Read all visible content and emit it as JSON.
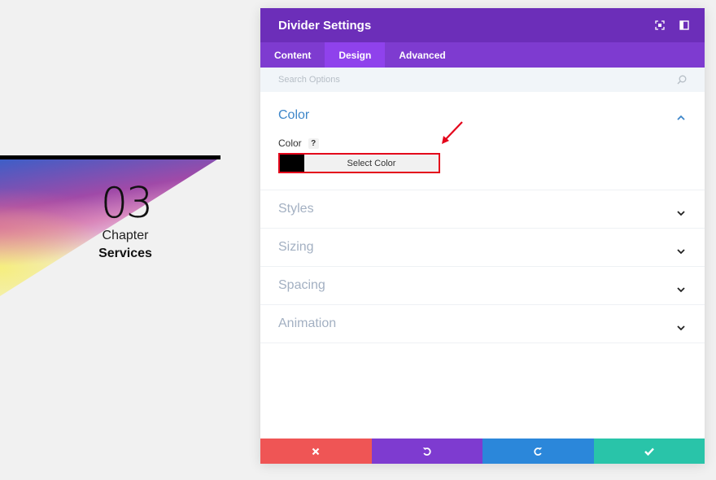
{
  "preview": {
    "number": "03",
    "chapter": "Chapter",
    "title": "Services"
  },
  "modal": {
    "title": "Divider Settings",
    "tabs": [
      {
        "label": "Content",
        "active": false
      },
      {
        "label": "Design",
        "active": true
      },
      {
        "label": "Advanced",
        "active": false
      }
    ],
    "search": {
      "placeholder": "Search Options",
      "value": ""
    },
    "color_section": {
      "title": "Color",
      "field_label": "Color",
      "help": "?",
      "swatch_color": "#000000",
      "button_label": "Select Color"
    },
    "sections": [
      {
        "title": "Styles"
      },
      {
        "title": "Sizing"
      },
      {
        "title": "Spacing"
      },
      {
        "title": "Animation"
      }
    ]
  },
  "colors": {
    "header": "#6c2eb9",
    "tabs": "#7e3bd0",
    "cancel": "#ef5555",
    "undo": "#7e3bd0",
    "redo": "#2b87da",
    "save": "#29c4a9",
    "highlight": "#e4051b"
  },
  "icons": {
    "header": [
      "expand-icon",
      "sidebar-toggle-icon"
    ],
    "footer": [
      "close-icon",
      "undo-icon",
      "redo-icon",
      "checkmark-icon"
    ]
  }
}
